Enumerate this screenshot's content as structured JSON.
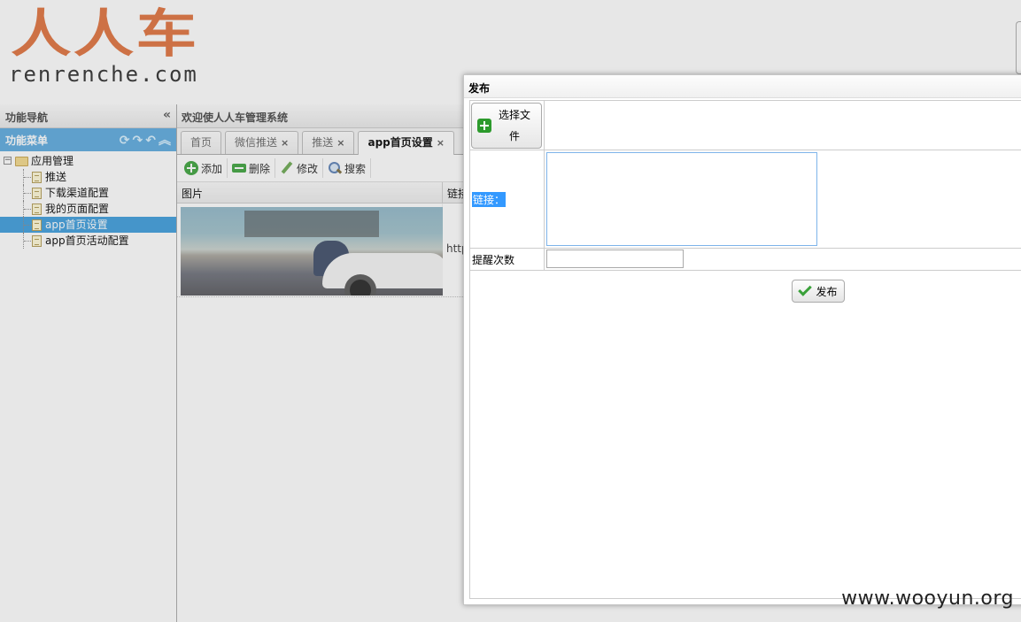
{
  "header": {
    "logo_cn": "人人车",
    "logo_en": "renrenche.com"
  },
  "nav": {
    "title": "功能导航",
    "collapse_icon": "double-chevron-left",
    "menu_title": "功能菜单",
    "menu_tools": [
      "refresh-icon",
      "redo-icon",
      "undo-icon",
      "collapse-up-icon"
    ],
    "tree": {
      "root": "应用管理",
      "items": [
        {
          "label": "推送",
          "selected": false
        },
        {
          "label": "下载渠道配置",
          "selected": false
        },
        {
          "label": "我的页面配置",
          "selected": false
        },
        {
          "label": "app首页设置",
          "selected": true
        },
        {
          "label": "app首页活动配置",
          "selected": false
        }
      ]
    }
  },
  "main": {
    "title": "欢迎使人人车管理系统",
    "tabs": [
      {
        "label": "首页",
        "closable": false,
        "active": false
      },
      {
        "label": "微信推送",
        "closable": true,
        "active": false
      },
      {
        "label": "推送",
        "closable": true,
        "active": false
      },
      {
        "label": "app首页设置",
        "closable": true,
        "active": true
      }
    ],
    "close_glyph": "×",
    "toolbar": {
      "add": "添加",
      "delete": "删除",
      "edit": "修改",
      "search": "搜索"
    },
    "grid": {
      "columns": [
        "图片",
        "链接"
      ],
      "rows": [
        {
          "link": "http"
        }
      ]
    }
  },
  "dialog": {
    "title": "发布",
    "file_button": "选择文件",
    "link_label": "链接：",
    "link_value": "",
    "count_label": "提醒次数",
    "count_value": "",
    "publish_button": "发布"
  },
  "watermark": "www.wooyun.org",
  "colors": {
    "brand": "#e0703a",
    "menu_header": "#5aa9df",
    "selected": "#3a9bdc",
    "icon_green": "#3aa13a"
  }
}
